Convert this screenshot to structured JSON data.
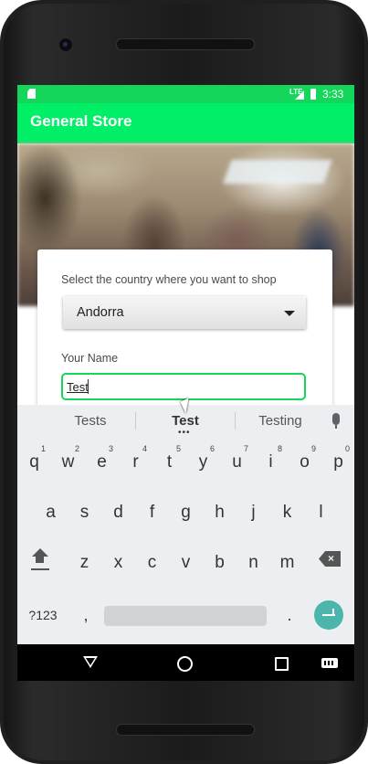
{
  "status_bar": {
    "network": "LTE",
    "time": "3:33"
  },
  "app_bar": {
    "title": "General Store"
  },
  "form": {
    "country_label": "Select the country where you want to shop",
    "country_value": "Andorra",
    "name_label": "Your Name",
    "name_value": "Test"
  },
  "keyboard": {
    "suggestions": [
      "Tests",
      "Test",
      "Testing"
    ],
    "row1": [
      {
        "key": "q",
        "hint": "1"
      },
      {
        "key": "w",
        "hint": "2"
      },
      {
        "key": "e",
        "hint": "3"
      },
      {
        "key": "r",
        "hint": "4"
      },
      {
        "key": "t",
        "hint": "5"
      },
      {
        "key": "y",
        "hint": "6"
      },
      {
        "key": "u",
        "hint": "7"
      },
      {
        "key": "i",
        "hint": "8"
      },
      {
        "key": "o",
        "hint": "9"
      },
      {
        "key": "p",
        "hint": "0"
      }
    ],
    "row2": [
      "a",
      "s",
      "d",
      "f",
      "g",
      "h",
      "j",
      "k",
      "l"
    ],
    "row3": [
      "z",
      "x",
      "c",
      "v",
      "b",
      "n",
      "m"
    ],
    "symbols_label": "?123",
    "comma": ",",
    "period": "."
  },
  "icons": {
    "sim": "sim-card-icon",
    "signal": "signal-icon",
    "battery": "battery-charging-icon",
    "mic": "microphone-icon",
    "shift": "shift-icon",
    "backspace": "backspace-icon",
    "enter": "enter-icon",
    "nav_back": "back-triangle-icon",
    "nav_home": "home-circle-icon",
    "nav_recents": "recents-square-icon",
    "nav_keyboard": "keyboard-icon"
  },
  "colors": {
    "status_bar": "#14d65a",
    "app_bar": "#00ef66",
    "input_focus": "#14d65a",
    "enter_key": "#4db6ac"
  }
}
